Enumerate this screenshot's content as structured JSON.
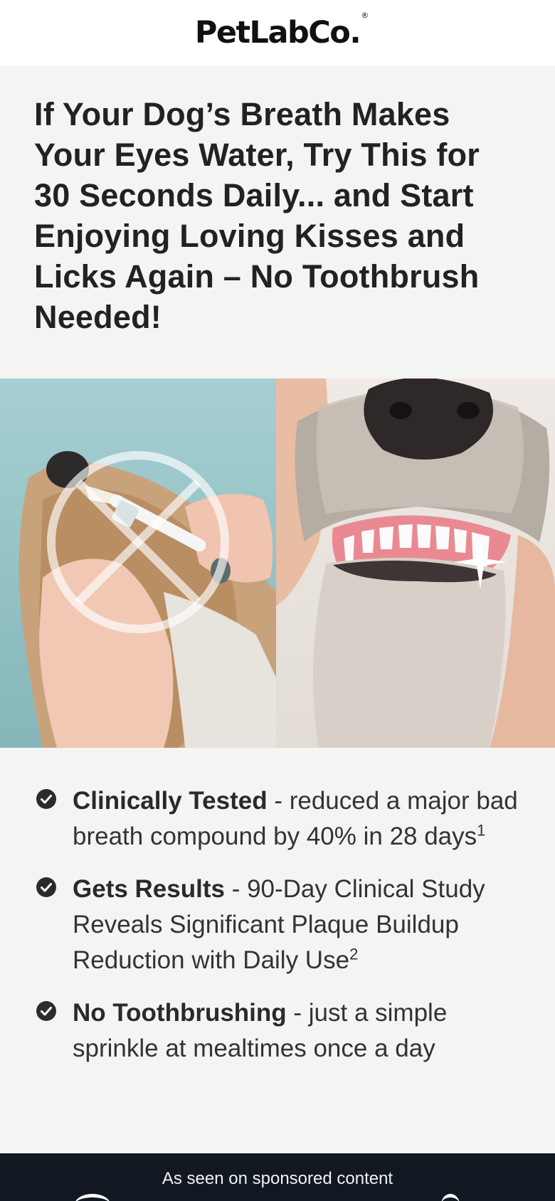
{
  "brand": {
    "name": "PetLabCo.",
    "registered_mark": "®"
  },
  "headline": "If Your Dog’s Breath Makes Your Eyes Water, Try This for 30 Seconds Daily... and Start Enjoying Loving Kisses and Licks Again – No Toothbrush Needed!",
  "features": [
    {
      "title": "Clinically Tested",
      "text": " - reduced a major bad breath compound by 40% in 28 days",
      "footnote": "1"
    },
    {
      "title": "Gets Results",
      "text": " - 90-Day Clinical Study Reveals Significant Plaque Buildup Reduction with Daily Use",
      "footnote": "2"
    },
    {
      "title": "No Toothbrushing",
      "text": " - just a simple sprinkle at mealtimes once a day",
      "footnote": ""
    }
  ],
  "footer": {
    "text": "As seen on sponsored content"
  },
  "colors": {
    "background": "#f4f4f2",
    "footer_bg": "#111822",
    "text": "#222222"
  }
}
